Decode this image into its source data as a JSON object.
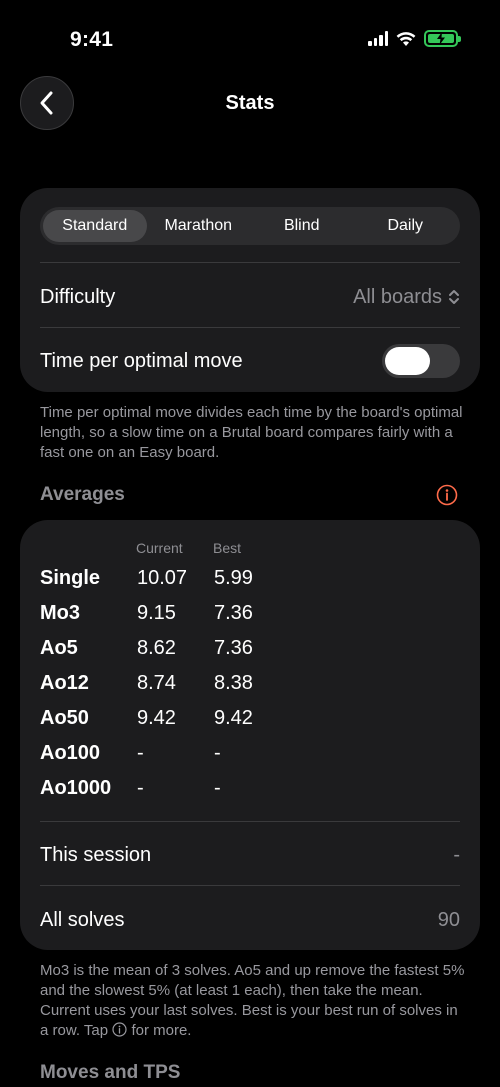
{
  "status": {
    "time": "9:41"
  },
  "nav": {
    "title": "Stats"
  },
  "modes": [
    "Standard",
    "Marathon",
    "Blind",
    "Daily"
  ],
  "settings": {
    "difficulty_label": "Difficulty",
    "difficulty_value": "All boards",
    "tpom_label": "Time per optimal move",
    "tpom_on": false
  },
  "settings_footnote": "Time per optimal move divides each time by the board's optimal length, so a slow time on a Brutal board compares fairly with a fast one on an Easy board.",
  "averages": {
    "header": "Averages",
    "col_current": "Current",
    "col_best": "Best",
    "rows": [
      {
        "label": "Single",
        "current": "10.07",
        "best": "5.99"
      },
      {
        "label": "Mo3",
        "current": "9.15",
        "best": "7.36"
      },
      {
        "label": "Ao5",
        "current": "8.62",
        "best": "7.36"
      },
      {
        "label": "Ao12",
        "current": "8.74",
        "best": "8.38"
      },
      {
        "label": "Ao50",
        "current": "9.42",
        "best": "9.42"
      },
      {
        "label": "Ao100",
        "current": "-",
        "best": "-"
      },
      {
        "label": "Ao1000",
        "current": "-",
        "best": "-"
      }
    ],
    "session_label": "This session",
    "session_value": "-",
    "all_label": "All solves",
    "all_value": "90"
  },
  "averages_footnote_before": "Mo3 is the mean of 3 solves. Ao5 and up remove the fastest 5% and the slowest 5% (at least 1 each), then take the mean. Current uses your last solves. Best is your best run of solves in a row. Tap",
  "averages_footnote_after": "for more.",
  "moves_header": "Moves and TPS",
  "colors": {
    "accent_info": "#ff6b4a",
    "battery": "#34c759"
  }
}
